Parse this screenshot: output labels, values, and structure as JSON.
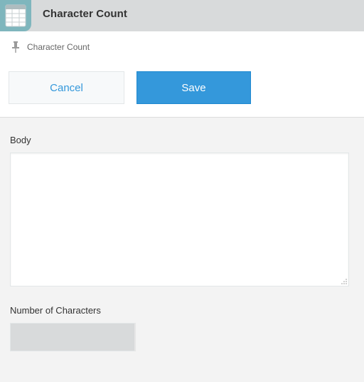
{
  "header": {
    "title": "Character Count",
    "app_icon": "spreadsheet-icon"
  },
  "breadcrumb": {
    "label": "Character Count",
    "icon": "pin-icon"
  },
  "actions": {
    "cancel_label": "Cancel",
    "save_label": "Save"
  },
  "form": {
    "body_label": "Body",
    "body_value": "",
    "count_label": "Number of Characters",
    "count_value": ""
  },
  "colors": {
    "header_bg": "#d8dadb",
    "app_icon_bg": "#7fb6bd",
    "accent": "#3498db",
    "page_bg": "#f3f3f3"
  }
}
